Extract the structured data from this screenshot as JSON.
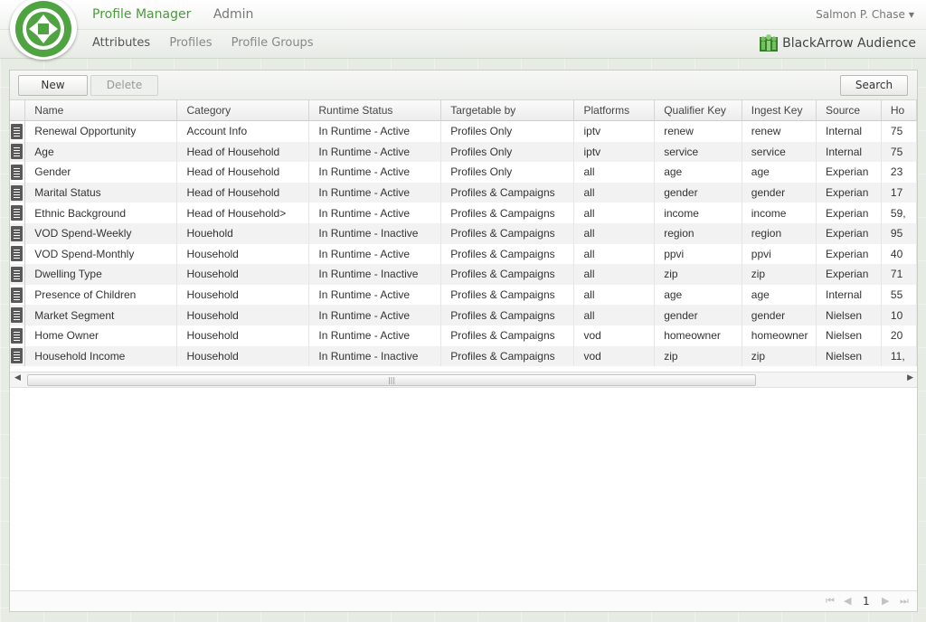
{
  "header": {
    "nav_primary": [
      "Profile Manager",
      "Admin"
    ],
    "nav_secondary": [
      "Attributes",
      "Profiles",
      "Profile Groups"
    ],
    "user_name": "Salmon P. Chase",
    "brand_name": "BlackArrow Audience",
    "accent_color": "#4a9b3d"
  },
  "toolbar": {
    "new_label": "New",
    "delete_label": "Delete",
    "search_label": "Search"
  },
  "grid": {
    "columns": [
      "Name",
      "Category",
      "Runtime Status",
      "Targetable by",
      "Platforms",
      "Qualifier Key",
      "Ingest Key",
      "Source",
      "Ho"
    ],
    "rows": [
      [
        "Renewal Opportunity",
        "Account Info",
        "In Runtime - Active",
        "Profiles Only",
        "iptv",
        "renew",
        "renew",
        "Internal",
        "75"
      ],
      [
        "Age",
        "Head of Household",
        "In Runtime - Active",
        "Profiles Only",
        "iptv",
        "service",
        "service",
        "Internal",
        "75"
      ],
      [
        "Gender",
        "Head of Household",
        "In Runtime - Active",
        "Profiles Only",
        "all",
        "age",
        "age",
        "Experian",
        "23"
      ],
      [
        "Marital Status",
        "Head of Household",
        "In Runtime - Active",
        "Profiles & Campaigns",
        "all",
        "gender",
        "gender",
        "Experian",
        "17"
      ],
      [
        "Ethnic Background",
        "Head of Household>",
        "In Runtime - Active",
        "Profiles & Campaigns",
        "all",
        "income",
        "income",
        "Experian",
        "59,"
      ],
      [
        "VOD Spend-Weekly",
        "Houehold",
        "In Runtime - Inactive",
        "Profiles & Campaigns",
        "all",
        "region",
        "region",
        "Experian",
        "95"
      ],
      [
        "VOD Spend-Monthly",
        "Household",
        "In Runtime - Active",
        "Profiles & Campaigns",
        "all",
        "ppvi",
        "ppvi",
        "Experian",
        "40"
      ],
      [
        "Dwelling Type",
        "Household",
        "In Runtime - Inactive",
        "Profiles & Campaigns",
        "all",
        "zip",
        "zip",
        "Experian",
        "71"
      ],
      [
        "Presence of Children",
        "Household",
        "In Runtime - Active",
        "Profiles & Campaigns",
        "all",
        "age",
        "age",
        "Internal",
        "55"
      ],
      [
        "Market Segment",
        "Household",
        "In Runtime - Active",
        "Profiles & Campaigns",
        "all",
        "gender",
        "gender",
        "Nielsen",
        "10"
      ],
      [
        "Home Owner",
        "Household",
        "In Runtime - Active",
        "Profiles & Campaigns",
        "vod",
        "homeowner",
        "homeowner",
        "Nielsen",
        "20"
      ],
      [
        "Household Income",
        "Household",
        "In Runtime - Inactive",
        "Profiles & Campaigns",
        "vod",
        "zip",
        "zip",
        "Nielsen",
        "11,"
      ]
    ]
  },
  "scrollbar": {
    "grip": "|||"
  },
  "pager": {
    "first": "⏮",
    "prev": "◀",
    "page": "1",
    "next": "▶",
    "last": "⏭"
  },
  "icons": {
    "row_menu": "list-icon",
    "user_caret": "▼",
    "scroll_left": "◀",
    "scroll_right": "▶"
  }
}
